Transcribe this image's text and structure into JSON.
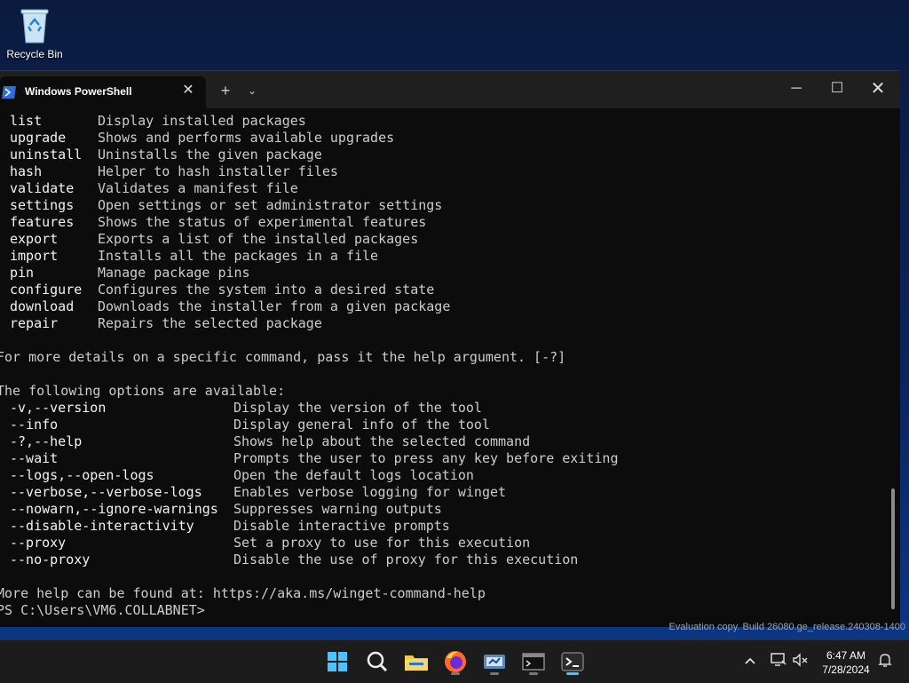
{
  "desktop": {
    "recycle_bin_label": "Recycle Bin"
  },
  "window": {
    "tab_title": "Windows PowerShell",
    "tab_close": "✕",
    "new_tab": "+",
    "dropdown": "⌄",
    "minimize": "─",
    "maximize": "☐",
    "close": "✕"
  },
  "terminal": {
    "commands": [
      {
        "cmd": "list",
        "desc": "Display installed packages"
      },
      {
        "cmd": "upgrade",
        "desc": "Shows and performs available upgrades"
      },
      {
        "cmd": "uninstall",
        "desc": "Uninstalls the given package"
      },
      {
        "cmd": "hash",
        "desc": "Helper to hash installer files"
      },
      {
        "cmd": "validate",
        "desc": "Validates a manifest file"
      },
      {
        "cmd": "settings",
        "desc": "Open settings or set administrator settings"
      },
      {
        "cmd": "features",
        "desc": "Shows the status of experimental features"
      },
      {
        "cmd": "export",
        "desc": "Exports a list of the installed packages"
      },
      {
        "cmd": "import",
        "desc": "Installs all the packages in a file"
      },
      {
        "cmd": "pin",
        "desc": "Manage package pins"
      },
      {
        "cmd": "configure",
        "desc": "Configures the system into a desired state"
      },
      {
        "cmd": "download",
        "desc": "Downloads the installer from a given package"
      },
      {
        "cmd": "repair",
        "desc": "Repairs the selected package"
      }
    ],
    "details_line": "For more details on a specific command, pass it the help argument. [-?]",
    "options_header": "The following options are available:",
    "options": [
      {
        "opt": "-v,--version",
        "desc": "Display the version of the tool"
      },
      {
        "opt": "--info",
        "desc": "Display general info of the tool"
      },
      {
        "opt": "-?,--help",
        "desc": "Shows help about the selected command"
      },
      {
        "opt": "--wait",
        "desc": "Prompts the user to press any key before exiting"
      },
      {
        "opt": "--logs,--open-logs",
        "desc": "Open the default logs location"
      },
      {
        "opt": "--verbose,--verbose-logs",
        "desc": "Enables verbose logging for winget"
      },
      {
        "opt": "--nowarn,--ignore-warnings",
        "desc": "Suppresses warning outputs"
      },
      {
        "opt": "--disable-interactivity",
        "desc": "Disable interactive prompts"
      },
      {
        "opt": "--proxy",
        "desc": "Set a proxy to use for this execution"
      },
      {
        "opt": "--no-proxy",
        "desc": "Disable the use of proxy for this execution"
      }
    ],
    "more_help": "More help can be found at: https://aka.ms/winget-command-help",
    "prompt": "PS C:\\Users\\VM6.COLLABNET>"
  },
  "watermark": "Evaluation copy. Build 26080.ge_release.240308-1400",
  "taskbar": {
    "time": "6:47 AM",
    "date": "7/28/2024",
    "icons": [
      "start-icon",
      "search-icon",
      "file-explorer-icon",
      "firefox-icon",
      "network-tool-icon",
      "cmd-icon",
      "terminal-icon"
    ],
    "tray": [
      "chevron-up-icon",
      "network-icon",
      "volume-muted-icon",
      "notification-bell-icon"
    ]
  },
  "colors": {
    "terminal_bg": "#0c0c0c",
    "titlebar_bg": "#1f1f1f",
    "taskbar_bg": "#1c1c1c",
    "accent": "#4cc2ff"
  }
}
